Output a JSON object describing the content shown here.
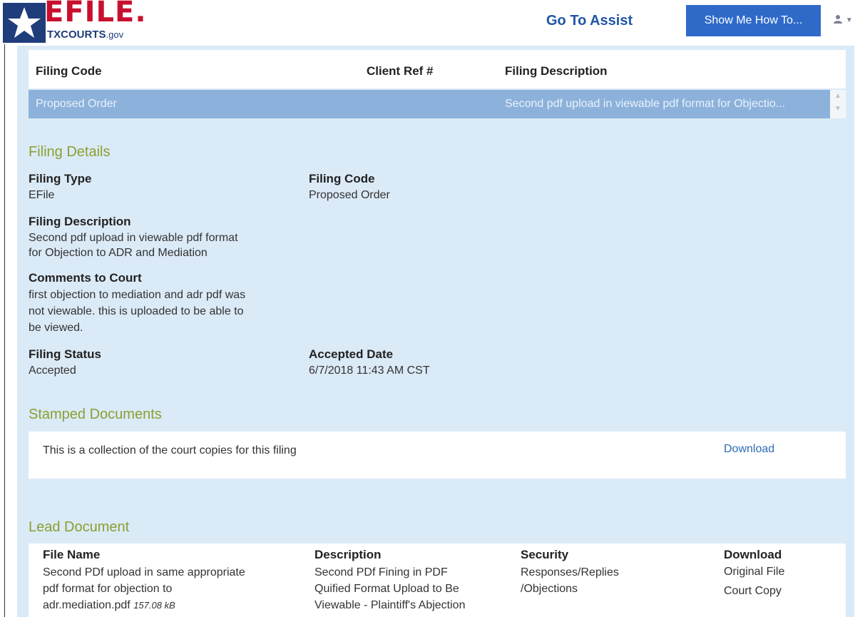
{
  "header": {
    "logo_top": "EFILE.",
    "logo_sub": "TXCOURTS",
    "logo_dom": ".gov",
    "go_assist": "Go To Assist",
    "show_me": "Show Me How To...",
    "user_icon": "user-icon"
  },
  "grid": {
    "columns": [
      "Filing Code",
      "Client Ref #",
      "Filing Description"
    ],
    "selected_row": {
      "code": "Proposed Order",
      "client_ref": "",
      "description": "Second pdf upload in viewable pdf format for Objectio..."
    }
  },
  "details": {
    "title": "Filing Details",
    "filing_type_label": "Filing Type",
    "filing_type": "EFile",
    "filing_code_label": "Filing Code",
    "filing_code": "Proposed Order",
    "desc_label": "Filing Description",
    "desc_line1": "Second pdf upload in viewable pdf format",
    "desc_line2": "for Objection to ADR and Mediation",
    "comments_label": "Comments to Court",
    "comments_line1": "first objection to mediation and adr pdf was",
    "comments_line2": "not viewable. this is uploaded to be able to",
    "comments_line3": "be viewed.",
    "status_label": "Filing Status",
    "status": "Accepted",
    "accepted_label": "Accepted Date",
    "accepted_date": "6/7/2018 11:43 AM CST"
  },
  "stamped": {
    "title": "Stamped Documents",
    "text": "This is a collection of the court copies for this filing",
    "download": "Download"
  },
  "lead": {
    "title": "Lead Document",
    "col_file": "File Name",
    "col_desc": "Description",
    "col_security": "Security",
    "col_download": "Download",
    "file_line1": "Second PDf upload in same appropriate",
    "file_line2": "pdf format for objection to",
    "file_line3": "adr.mediation.pdf",
    "file_size": "157.08 kB",
    "desc_line1": "Second PDf Fining in PDF",
    "desc_line2": "Quified Format Upload to Be",
    "desc_line3": "Viewable - Plaintiff's Abjection",
    "security_line1": "Responses/Replies",
    "security_line2": "/Objections",
    "original_file": "Original File",
    "court_copy": "Court Copy"
  },
  "colors": {
    "panel_bg": "#dbeaf7",
    "selected_row": "#8cb2db",
    "section_title": "#8aa030",
    "link": "#2d6cb5",
    "button": "#2f6ac9",
    "logo_red": "#c8102e",
    "logo_blue": "#1f3d7a"
  }
}
